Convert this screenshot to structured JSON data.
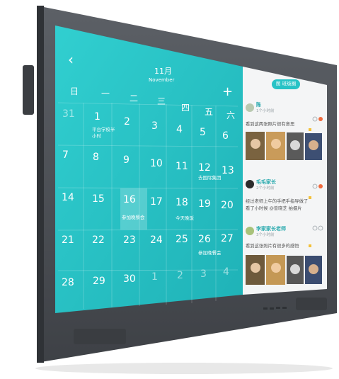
{
  "calendar": {
    "month": "11月",
    "month_en": "November",
    "weekdays": [
      "日",
      "一",
      "二",
      "三",
      "四",
      "五",
      "六"
    ],
    "weeks": [
      [
        "31",
        "1",
        "2",
        "3",
        "4",
        "5",
        "6"
      ],
      [
        "7",
        "8",
        "9",
        "10",
        "11",
        "12",
        "13"
      ],
      [
        "14",
        "15",
        "16",
        "17",
        "18",
        "19",
        "20"
      ],
      [
        "21",
        "22",
        "23",
        "24",
        "25",
        "26",
        "27"
      ],
      [
        "28",
        "29",
        "30",
        "1",
        "2",
        "3",
        "4"
      ]
    ],
    "events": {
      "e1": "平台学校半小时",
      "e1a": "平台学校半",
      "e1b": "小时",
      "e2": "去国际集团",
      "e3": "参加晚餐会",
      "e4": "今天晚饭",
      "e5": "参加晚餐会"
    },
    "selected": "16"
  },
  "feed": {
    "tab_label": "图 班级圈",
    "posts": [
      {
        "name": "陈",
        "sub": "1个小时前",
        "text": "看到这两张照片很有意思",
        "likes": "1"
      },
      {
        "name": "毛毛家长",
        "sub": "2个小时前",
        "text_a": "经过老师上午的手把手指导做了",
        "text_b": "看了小时候 @曾晓芝 拍摄片"
      },
      {
        "name": "李家家长老师",
        "sub": "3个小时前",
        "text": "看到这张照片有很多的感悟"
      }
    ]
  },
  "colors": {
    "screen_teal": "#27c3c6",
    "bezel": "#4a4d52",
    "feed_bg": "#f4f5f6"
  }
}
